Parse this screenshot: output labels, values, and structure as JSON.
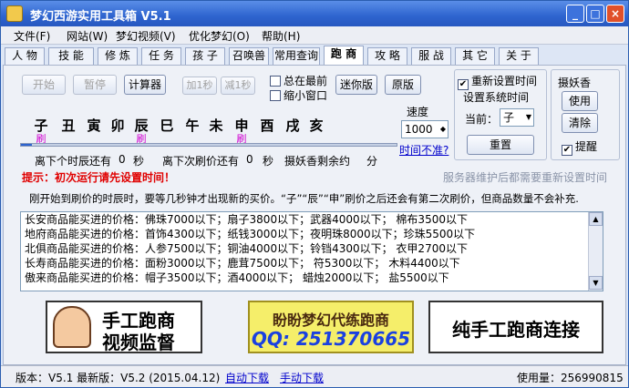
{
  "window": {
    "title": "梦幻西游实用工具箱 V5.1"
  },
  "menu": [
    "文件(F)",
    "网站(W)",
    "梦幻视频(V)",
    "优化梦幻(O)",
    "帮助(H)"
  ],
  "tabs": [
    "人 物",
    "技 能",
    "修 炼",
    "任 务",
    "孩 子",
    "召唤兽",
    "常用查询",
    "跑 商",
    "攻 略",
    "服 战",
    "其 它",
    "关 于"
  ],
  "active_tab": "跑 商",
  "controls": {
    "start": "开始",
    "pause": "暂停",
    "calculator": "计算器",
    "add_sec": "加1秒",
    "sub_sec": "减1秒",
    "always_top": "总在最前",
    "mini_window": "缩小窗口",
    "mini_ver": "迷你版",
    "original": "原版",
    "reset_time_chk": "重新设置时间",
    "set_sys_time": "设置系统时间",
    "current_label": "当前：",
    "current_value": "子",
    "reset": "重置",
    "incense_label": "摄妖香",
    "use": "使用",
    "clear": "清除",
    "remind": "提醒",
    "speed_label": "速度",
    "speed_value": "1000",
    "time_inaccurate": "时间不准?"
  },
  "zodiac": [
    "子",
    "丑",
    "寅",
    "卯",
    "辰",
    "巳",
    "午",
    "未",
    "申",
    "酉",
    "戌",
    "亥"
  ],
  "refresh_mark": "刷",
  "refresh_indices": [
    0,
    4,
    8
  ],
  "progress": 0.03,
  "status_row": {
    "period_left": "离下个时辰还有",
    "period_val": "0",
    "sec1": "秒",
    "next_refresh": "离下次刷价还有",
    "refresh_val": "0",
    "sec2": "秒",
    "incense_left": "摄妖香剩余约",
    "incense_unit": "分"
  },
  "tip": "提示：初次运行请先设置时间！",
  "server_note": "服务器维护后都需要重新设置时间",
  "notice": "刚开始到刷价的时辰时，要等几秒钟才出现新的买价。“子”“辰”“申”刷价之后还会有第二次刷价，但商品数量不会补充.",
  "log": [
    "长安商品能买进的价格：佛珠7000以下；扇子3800以下；武器4000以下；    棉布3500以下",
    "地府商品能买进的价格：首饰4300以下；纸钱3000以下；夜明珠8000以下；珍珠5500以下",
    "北俱商品能买进的价格：人参7500以下；铜油4000以下；铃铛4300以下；    衣甲2700以下",
    "长寿商品能买进的价格：面粉3000以下；鹿茸7500以下；  符5300以下；      木料4400以下",
    "傲来商品能买进的价格：帽子3500以下；酒4000以下；    蜡烛2000以下；    盐5500以下"
  ],
  "banners": {
    "left_line1": "手工跑商",
    "left_line2": "视频监督",
    "mid_line1": "盼盼梦幻代练跑商",
    "mid_line2": "QQ: 251370665",
    "right": "纯手工跑商连接"
  },
  "statusbar": {
    "version": "版本：V5.1 最新版：V5.2 (2015.04.12)",
    "auto_dl": "自动下载",
    "manual_dl": "手动下载",
    "usage": "使用量：256990815"
  }
}
